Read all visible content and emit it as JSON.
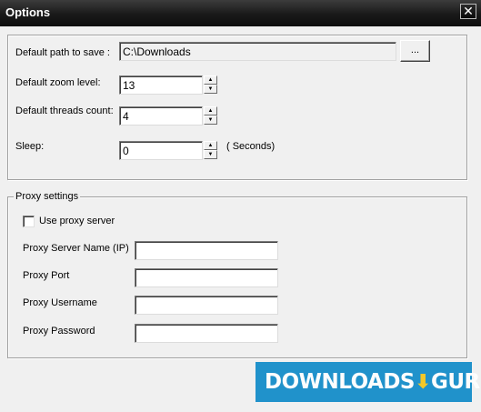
{
  "window": {
    "title": "Options",
    "close_glyph": "✕"
  },
  "main": {
    "path_label": "Default path to save :",
    "path_value": "C:\\Downloads",
    "browse_label": "...",
    "zoom_label": "Default zoom level:",
    "zoom_value": "13",
    "threads_label": "Default threads count:",
    "threads_value": "4",
    "sleep_label": "Sleep:",
    "sleep_value": "0",
    "sleep_unit": "( Seconds)"
  },
  "proxy": {
    "legend": "Proxy settings",
    "use_proxy_label": "Use proxy server",
    "use_proxy_checked": false,
    "server_label": "Proxy Server Name (IP)",
    "server_value": "",
    "port_label": "Proxy Port",
    "port_value": "",
    "username_label": "Proxy Username",
    "username_value": "",
    "password_label": "Proxy Password",
    "password_value": ""
  },
  "icons": {
    "spin_up": "▲",
    "spin_down": "▼"
  },
  "watermark": {
    "text_left": "DOWNLOADS",
    "arrow": "⬇",
    "text_right": "GURU"
  }
}
